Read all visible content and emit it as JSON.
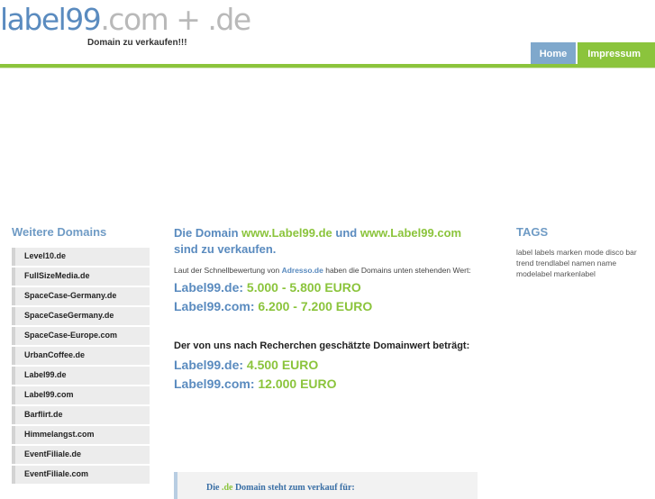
{
  "header": {
    "logo_main": "label99",
    "logo_rest": ".com + .de",
    "tagline": "Domain zu verkaufen!!!",
    "nav": [
      {
        "label": "Home"
      },
      {
        "label": "Impressum"
      }
    ]
  },
  "sidebar": {
    "title": "Weitere Domains",
    "items": [
      "Level10.de",
      "FullSizeMedia.de",
      "SpaceCase-Germany.de",
      "SpaceCaseGermany.de",
      "SpaceCase-Europe.com",
      "UrbanCoffee.de",
      "Label99.de",
      "Label99.com",
      "Barflirt.de",
      "Himmelangst.com",
      "EventFiliale.de",
      "EventFiliale.com"
    ]
  },
  "main": {
    "heading_pre": "Die Domain ",
    "heading_d1": "www.Label99.de",
    "heading_mid": " und ",
    "heading_d2": "www.Label99.com",
    "heading_post": " sind zu verkaufen.",
    "text_pre": "Laut der Schnellbewertung von ",
    "text_link": "Adresso.de",
    "text_post": " haben die Domains unten stehenden Wert:",
    "prices1": [
      {
        "domain": "Label99.de:",
        "value": "5.000 - 5.800 EURO"
      },
      {
        "domain": "Label99.com:",
        "value": "6.200 - 7.200 EURO"
      }
    ],
    "estimate_heading": "Der von uns nach Recherchen geschätzte Domainwert beträgt:",
    "prices2": [
      {
        "domain": "Label99.de:",
        "value": "4.500 EURO"
      },
      {
        "domain": "Label99.com:",
        "value": "12.000 EURO"
      }
    ],
    "box_pre": "Die ",
    "box_accent": ".de",
    "box_post": " Domain steht zum verkauf für:"
  },
  "tags": {
    "title": "TAGS",
    "text": "label labels marken mode disco bar trend trendlabel namen name modelabel markenlabel"
  },
  "colors": {
    "blue": "#5a8bbf",
    "green": "#8bc43c",
    "nav_home": "#7fa8cc"
  }
}
